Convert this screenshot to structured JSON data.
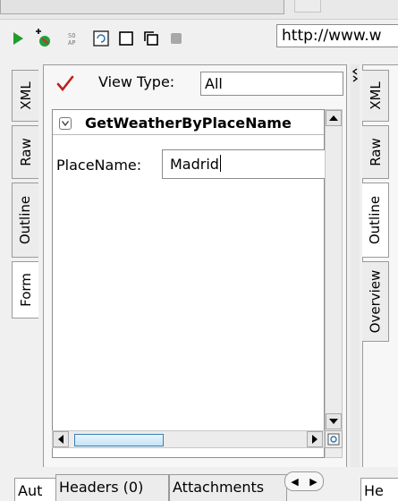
{
  "toolbar": {
    "icons": [
      "run-icon",
      "add-assertion-icon",
      "soap-icon",
      "screen-icon",
      "square-icon",
      "copy-icon",
      "stop-icon"
    ],
    "url": "http://www.w"
  },
  "left_tabs": [
    "XML",
    "Raw",
    "Outline",
    "Form"
  ],
  "form": {
    "view_type_label": "View Type:",
    "view_type_value": "All",
    "operation": "GetWeatherByPlaceName",
    "field_label": "PlaceName:",
    "field_value": "Madrid"
  },
  "right_tabs": [
    "XML",
    "Raw",
    "Outline",
    "Overview"
  ],
  "bottom_tabs": [
    "Aut",
    "Headers (0)",
    "Attachments",
    "He"
  ]
}
